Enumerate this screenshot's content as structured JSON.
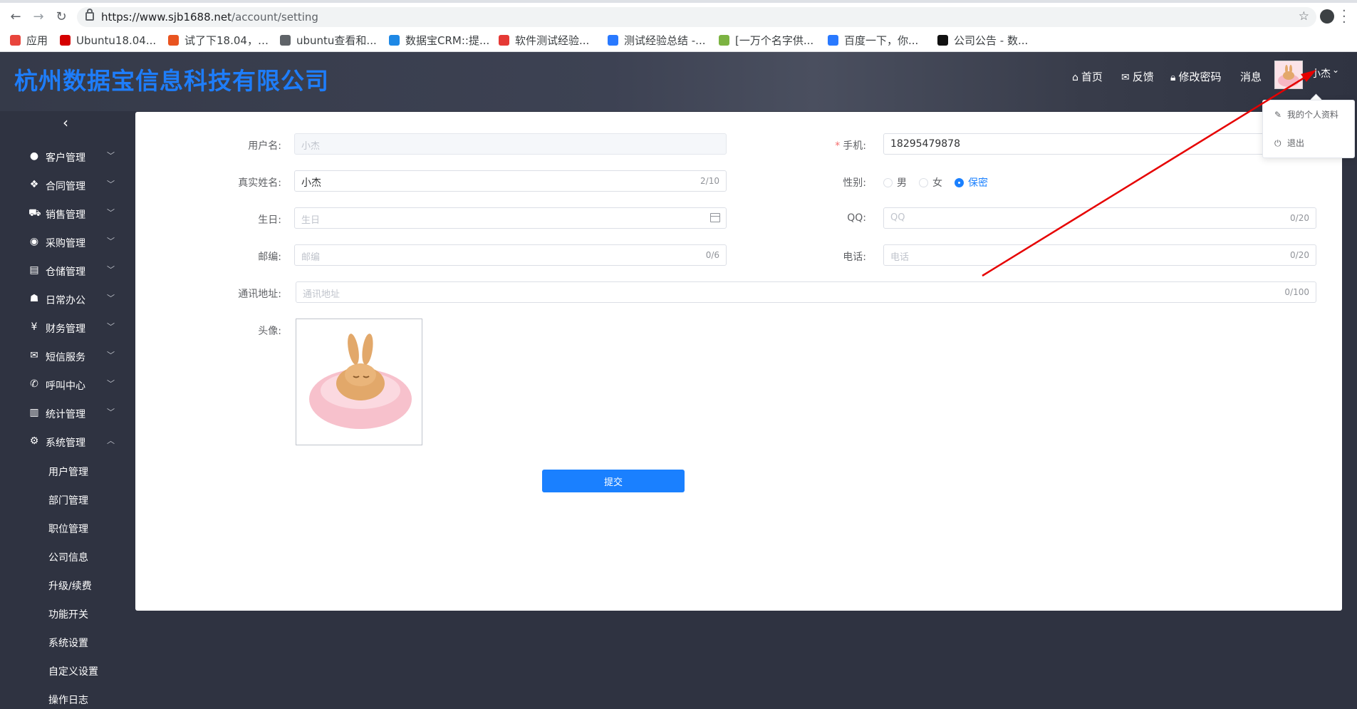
{
  "browser": {
    "url_host": "https://www.sjb1688.net",
    "url_path": "/account/setting",
    "bookmarks": [
      {
        "label": "应用",
        "color": "#e8453c"
      },
      {
        "label": "Ubuntu18.04...",
        "color": "#d50000"
      },
      {
        "label": "试了下18.04，…",
        "color": "#e95420"
      },
      {
        "label": "ubuntu查看和...",
        "color": "#5f6368"
      },
      {
        "label": "数据宝CRM::提...",
        "color": "#1e88e5"
      },
      {
        "label": "软件测试经验...",
        "color": "#e53935"
      },
      {
        "label": "测试经验总结 -...",
        "color": "#2979ff"
      },
      {
        "label": "[一万个名字供...",
        "color": "#7cb342"
      },
      {
        "label": "百度一下，你...",
        "color": "#2979ff"
      },
      {
        "label": "公司公告 - 数...",
        "color": "#111111"
      }
    ]
  },
  "header": {
    "brand": "杭州数据宝信息科技有限公司",
    "nav": {
      "home": "首页",
      "feedback": "反馈",
      "change_password": "修改密码",
      "messages": "消息"
    },
    "user_name": "小杰"
  },
  "dropdown": {
    "profile": "我的个人资料",
    "logout": "退出"
  },
  "sidebar": {
    "items": [
      {
        "label": "客户管理",
        "icon": "user-icon"
      },
      {
        "label": "合同管理",
        "icon": "contract-icon"
      },
      {
        "label": "销售管理",
        "icon": "cart-icon"
      },
      {
        "label": "采购管理",
        "icon": "purchase-icon"
      },
      {
        "label": "仓储管理",
        "icon": "store-icon"
      },
      {
        "label": "日常办公",
        "icon": "office-icon"
      },
      {
        "label": "财务管理",
        "icon": "yen-icon"
      },
      {
        "label": "短信服务",
        "icon": "mail-icon"
      },
      {
        "label": "呼叫中心",
        "icon": "phone-icon"
      },
      {
        "label": "统计管理",
        "icon": "chart-icon"
      },
      {
        "label": "系统管理",
        "icon": "gear-icon"
      }
    ],
    "sub_items": [
      "用户管理",
      "部门管理",
      "职位管理",
      "公司信息",
      "升级/续费",
      "功能开关",
      "系统设置",
      "自定义设置",
      "操作日志"
    ]
  },
  "form": {
    "username": {
      "label": "用户名:",
      "value": "小杰"
    },
    "realname": {
      "label": "真实姓名:",
      "value": "小杰",
      "count": "2/10"
    },
    "birthday": {
      "label": "生日:",
      "placeholder": "生日"
    },
    "zipcode": {
      "label": "邮编:",
      "placeholder": "邮编",
      "count": "0/6"
    },
    "address": {
      "label": "通讯地址:",
      "placeholder": "通讯地址",
      "count": "0/100"
    },
    "avatar": {
      "label": "头像:"
    },
    "mobile": {
      "label": "手机:",
      "required_mark": "*",
      "value": "18295479878"
    },
    "gender": {
      "label": "性别:",
      "options": [
        "男",
        "女",
        "保密"
      ],
      "selected": "保密"
    },
    "qq": {
      "label": "QQ:",
      "placeholder": "QQ",
      "count": "0/20"
    },
    "phone": {
      "label": "电话:",
      "placeholder": "电话",
      "count": "0/20"
    },
    "submit": "提交"
  },
  "colors": {
    "brand": "#1e7dfa",
    "primary": "#1a80ff",
    "sidebar_bg": "#2f3341",
    "annotation": "#e60000"
  }
}
